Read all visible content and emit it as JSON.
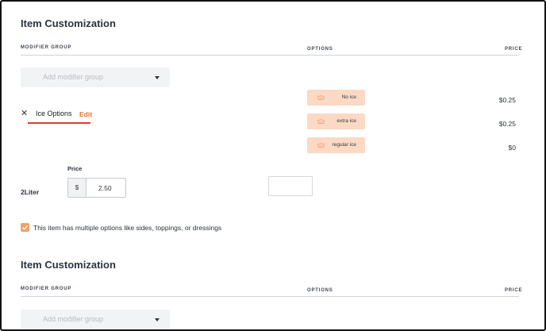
{
  "section1": {
    "title": "Item Customization",
    "col_modifier_group": "MODIFIER GROUP",
    "col_options": "OPTIONS",
    "col_price": "PRICE",
    "add_placeholder": "Add modifier group"
  },
  "modifier": {
    "name": "Ice Options",
    "edit_label": "Edit",
    "options": [
      {
        "label": "No ice",
        "price": "$0.25"
      },
      {
        "label": "extra ice",
        "price": "$0.25"
      },
      {
        "label": "regular ice",
        "price": "$0"
      }
    ]
  },
  "size": {
    "name": "2Liter",
    "price_label": "Price",
    "currency": "$",
    "price_value": "2.50"
  },
  "multiple_options": {
    "checked": true,
    "label": "This item has multiple options like sides, toppings, or dressings"
  },
  "section2": {
    "title": "Item Customization",
    "col_modifier_group": "MODIFIER GROUP",
    "col_options": "OPTIONS",
    "col_price": "PRICE",
    "add_placeholder": "Add modifier group"
  },
  "colors": {
    "accent_orange": "#e8742c",
    "chip_bg": "#fbd9c4",
    "checkbox": "#f4a261",
    "underline_red": "#e2392c"
  },
  "icons": {
    "remove": "close-icon",
    "dropdown": "chevron-down-icon",
    "option": "drink-icon",
    "checkbox": "checkmark-icon"
  }
}
